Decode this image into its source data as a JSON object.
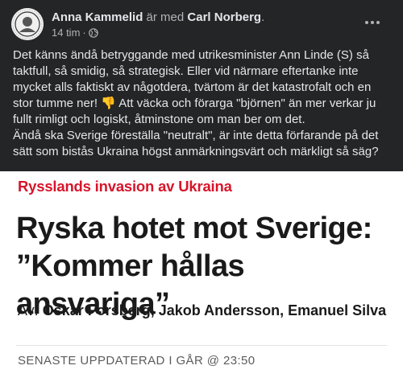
{
  "post": {
    "author": "Anna Kammelid",
    "with_text": "är med",
    "tagged": "Carl Norberg",
    "tagged_suffix": ".",
    "time": "14 tim",
    "separator": "·",
    "privacy_icon": "globe-icon",
    "more_icon": "more-options-icon",
    "body": "Det känns ändå betryggande med utrikesminister Ann Linde (S) så taktfull, så smidig, så strategisk. Eller vid närmare eftertanke inte mycket alls faktiskt av någotdera, tvärtom är det katastrofalt och en stor tumme ner! 👎 Att väcka och förarga \"björnen\" än mer verkar ju fullt rimligt och logiskt, åtminstone om man ber om det.\nÄndå ska Sverige föreställa \"neutralt\", är inte detta förfarande på det sätt som bistås Ukraina högst anmärkningsvärt och märkligt så säg?"
  },
  "article": {
    "section": "Rysslands invasion av Ukraina",
    "headline": "Ryska hotet mot Sverige: ”Kommer hållas ansvariga”",
    "byline_prefix": "Av: ",
    "byline_authors": "Oskar Forsberg, Jakob Andersson, Emanuel Silva",
    "updated": "SENASTE UPPDATERAD I GÅR @ 23:50"
  },
  "colors": {
    "post_bg": "#242526",
    "post_text": "#e4e6eb",
    "meta_text": "#b0b3b8",
    "section_red": "#d7152a",
    "headline_text": "#1a1a1a"
  }
}
